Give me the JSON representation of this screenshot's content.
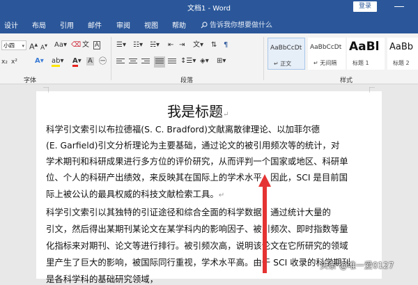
{
  "window": {
    "title": "文档1 - Word",
    "login_label": "登录"
  },
  "tabs": [
    "设计",
    "布局",
    "引用",
    "邮件",
    "审阅",
    "视图",
    "帮助"
  ],
  "tell_me": "告诉我你想要做什么",
  "font": {
    "size": "小四",
    "group_label": "字体"
  },
  "paragraph": {
    "group_label": "段落"
  },
  "styles": {
    "group_label": "样式",
    "items": [
      {
        "sample": "AaBbCcDt",
        "name": "↵ 正文"
      },
      {
        "sample": "AaBbCcDt",
        "name": "↵ 无间隔"
      },
      {
        "sample": "AaBl",
        "name": "标题 1"
      },
      {
        "sample": "AaBb",
        "name": "标题 2"
      }
    ]
  },
  "document": {
    "title": "我是标题",
    "lines": [
      "    科学引文索引以布拉德福(S. C. Bradford)文献离散律理论、以加菲尔德",
      "(E. Garfield)引文分析理论为主要基础，通过论文的被引用频次等的统计，对",
      "学术期刊和科研成果进行多方位的评价研究，从而评判一个国家或地区、科研单",
      "位、个人的科研产出绩效，来反映其在国际上的学术水平。因此，SCI 是目前国",
      "际上被公认的最具权威的科技文献检索工具。",
      "    科学引文索引以其独特的引证途径和综合全面的科学数据，通过统计大量的",
      "引文，然后得出某期刊某论文在某学科内的影响因子、被引频次、即时指数等量",
      "化指标来对期刊、论文等进行排行。被引频次高，说明该论文在它所研究的领域",
      "里产生了巨大的影响，被国际同行重视，学术水平高。由于 SCI 收录的科学期刊",
      "是各科学科的基础研究领域，"
    ],
    "mark": "↵"
  },
  "watermark": "头条 @唯一爱0127",
  "colors": {
    "accent": "#2b579a",
    "font_color": "#e8231e",
    "highlight": "#ffe500",
    "arrow": "#e53333"
  },
  "icons": [
    "search-icon",
    "font-color-icon",
    "highlight-icon",
    "bold-icon",
    "italic-icon",
    "underline-icon",
    "align-justify-icon",
    "arrow-up-icon"
  ]
}
